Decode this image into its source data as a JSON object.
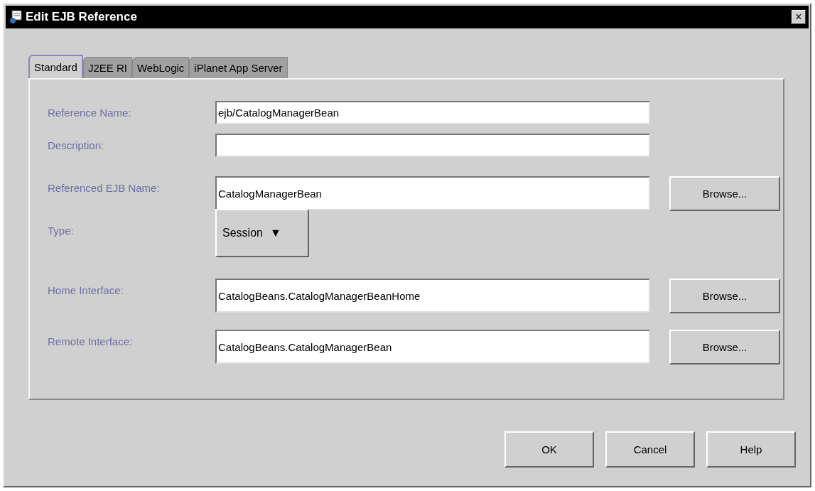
{
  "window": {
    "title": "Edit EJB Reference",
    "close": "×"
  },
  "tabs": [
    {
      "label": "Standard",
      "selected": true
    },
    {
      "label": "J2EE RI",
      "selected": false
    },
    {
      "label": "WebLogic",
      "selected": false
    },
    {
      "label": "iPlanet App Server",
      "selected": false
    }
  ],
  "fields": [
    {
      "kind": "text",
      "label": "Reference Name:",
      "value": "ejb/CatalogManagerBean"
    },
    {
      "kind": "text",
      "label": "Description:"
    },
    {
      "kind": "text",
      "label": "Referenced EJB Name:",
      "value": "CatalogManagerBean",
      "button": "Browse..."
    },
    {
      "kind": "combo",
      "label": "Type:",
      "value": "Session",
      "arrow": "▼"
    },
    {
      "kind": "text",
      "label": "Home Interface:",
      "value": "CatalogBeans.CatalogManagerBeanHome",
      "button": "Browse..."
    },
    {
      "kind": "text",
      "label": "Remote Interface:",
      "value": "CatalogBeans.CatalogManagerBean",
      "button": "Browse..."
    }
  ],
  "buttons": [
    "OK",
    "Cancel",
    "Help"
  ]
}
